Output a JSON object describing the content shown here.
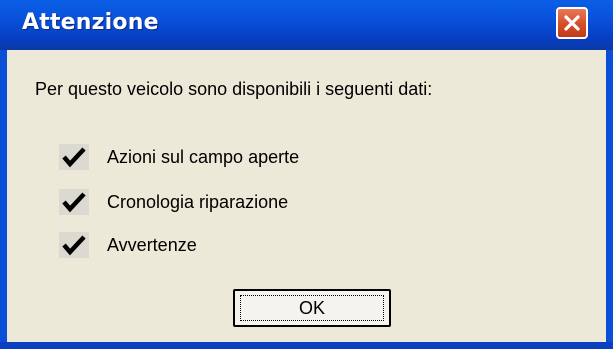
{
  "window": {
    "title": "Attenzione"
  },
  "message": {
    "text": "Per questo veicolo sono disponibili i seguenti dati:"
  },
  "items": [
    {
      "label": "Azioni sul campo aperte",
      "checked": true
    },
    {
      "label": "Cronologia riparazione",
      "checked": true
    },
    {
      "label": "Avvertenze",
      "checked": true
    }
  ],
  "buttons": {
    "ok_label": "OK"
  },
  "icons": {
    "close": "close-icon",
    "check": "checkmark-icon"
  },
  "colors": {
    "titlebar": "#0a52dc",
    "client": "#ece9d8",
    "close_button": "#d8512e"
  }
}
